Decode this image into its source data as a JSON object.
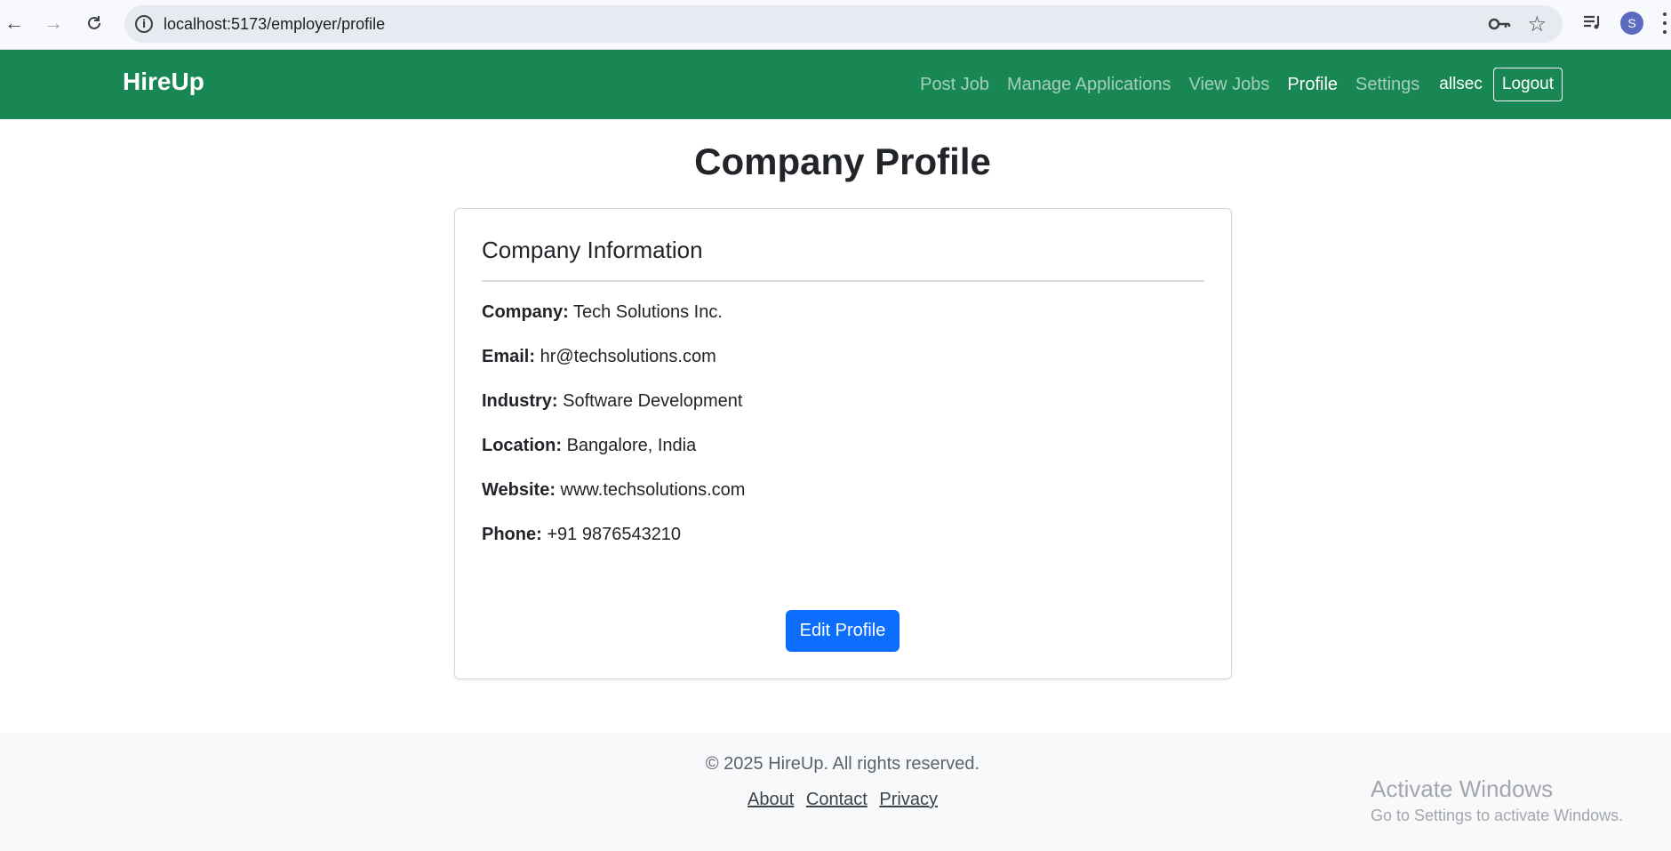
{
  "browser": {
    "url": "localhost:5173/employer/profile",
    "avatar_letter": "S"
  },
  "navbar": {
    "brand": "HireUp",
    "links": [
      "Post Job",
      "Manage Applications",
      "View Jobs",
      "Profile",
      "Settings"
    ],
    "active_link": "Profile",
    "username": "allsec",
    "logout_label": "Logout",
    "bg_color": "#198754"
  },
  "page": {
    "title": "Company Profile"
  },
  "card": {
    "title": "Company Information",
    "fields": [
      {
        "label": "Company:",
        "value": "Tech Solutions Inc."
      },
      {
        "label": "Email:",
        "value": "hr@techsolutions.com"
      },
      {
        "label": "Industry:",
        "value": "Software Development"
      },
      {
        "label": "Location:",
        "value": "Bangalore, India"
      },
      {
        "label": "Website:",
        "value": "www.techsolutions.com"
      },
      {
        "label": "Phone:",
        "value": "+91 9876543210"
      }
    ],
    "edit_label": "Edit Profile",
    "button_color": "#0d6efd"
  },
  "footer": {
    "copyright": "© 2025 HireUp. All rights reserved.",
    "links": [
      "About",
      "Contact",
      "Privacy"
    ]
  },
  "watermark": {
    "line1": "Activate Windows",
    "line2": "Go to Settings to activate Windows."
  }
}
